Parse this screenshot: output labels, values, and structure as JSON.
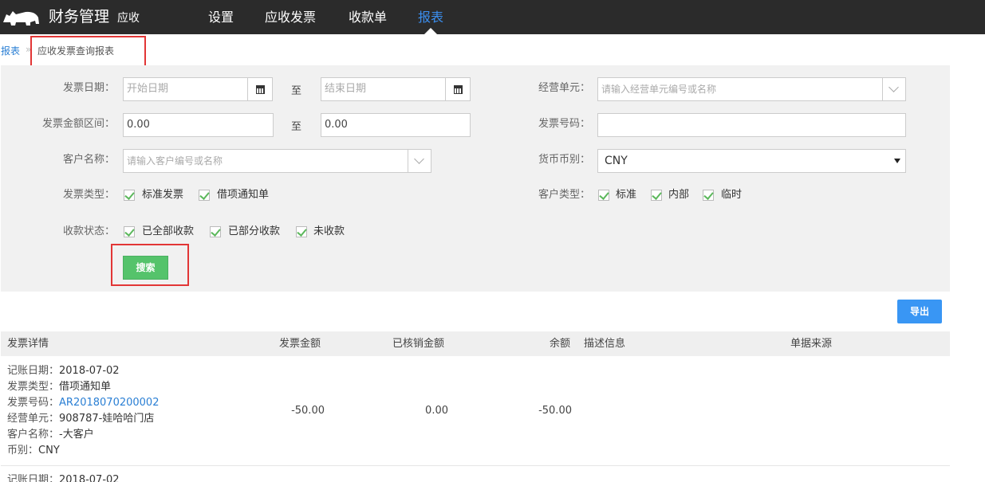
{
  "nav": {
    "brand": "财务管理",
    "brand_sub": "应收",
    "items": [
      "设置",
      "应收发票",
      "收款单",
      "报表"
    ],
    "active": "报表"
  },
  "breadcrumb": {
    "root": "报表",
    "separator": "»",
    "current": "应收发票查询报表"
  },
  "filters": {
    "invoice_date_label": "发票日期：",
    "start_date_placeholder": "开始日期",
    "end_date_placeholder": "结束日期",
    "to": "至",
    "amount_range_label": "发票金额区间：",
    "amount_min": "0.00",
    "amount_max": "0.00",
    "customer_label": "客户名称：",
    "customer_placeholder": "请输入客户编号或名称",
    "invoice_type_label": "发票类型：",
    "invoice_types": [
      "标准发票",
      "借项通知单"
    ],
    "status_label": "收款状态：",
    "statuses": [
      "已全部收款",
      "已部分收款",
      "未收款"
    ],
    "unit_label": "经营单元：",
    "unit_placeholder": "请输入经营单元编号或名称",
    "invoice_no_label": "发票号码：",
    "invoice_no_value": "",
    "currency_label": "货币币别：",
    "currency_value": "CNY",
    "customer_type_label": "客户类型：",
    "customer_types": [
      "标准",
      "内部",
      "临时"
    ]
  },
  "buttons": {
    "search": "搜索",
    "export": "导出"
  },
  "table": {
    "headers": [
      "发票详情",
      "发票金额",
      "已核销金额",
      "余额",
      "描述信息",
      "单据来源"
    ],
    "rows": [
      {
        "details": [
          {
            "label": "记账日期：",
            "value": "2018-07-02"
          },
          {
            "label": "发票类型：",
            "value": "借项通知单"
          },
          {
            "label": "发票号码：",
            "value": "AR2018070200002"
          },
          {
            "label": "经营单元：",
            "value": "908787-娃哈哈门店"
          },
          {
            "label": "客户名称：",
            "value": "-大客户"
          },
          {
            "label": "币别：",
            "value": "CNY"
          }
        ],
        "amount": "-50.00",
        "written_off": "0.00",
        "balance": "-50.00",
        "description": "",
        "source": ""
      }
    ],
    "next_row_first": {
      "label": "记账日期：",
      "value": "2018-07-02"
    }
  },
  "colors": {
    "nav_bg": "#2b2b2b",
    "accent": "#3b8ff0",
    "search_btn": "#55c36b",
    "export_btn": "#3996f4",
    "highlight": "#e23636"
  }
}
